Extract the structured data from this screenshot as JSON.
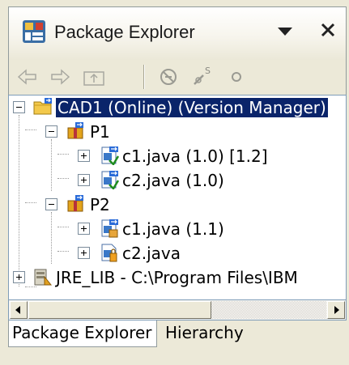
{
  "view": {
    "title": "Package Explorer"
  },
  "toolbar": {
    "buttons": [
      "back",
      "forward",
      "up",
      "collapse-all",
      "link-with-editor",
      "menu"
    ]
  },
  "tree": {
    "root": {
      "label": "CAD1 (Online) (Version Manager)",
      "expanded": true,
      "selected": true
    },
    "p1": {
      "label": "P1",
      "expanded": true
    },
    "p1_c1": {
      "label": "c1.java (1.0) [1.2]"
    },
    "p1_c2": {
      "label": "c2.java (1.0)"
    },
    "p2": {
      "label": "P2",
      "expanded": true
    },
    "p2_c1": {
      "label": "c1.java (1.1)"
    },
    "p2_c2": {
      "label": "c2.java"
    },
    "jre": {
      "label": "JRE_LIB - C:\\Program Files\\IBM"
    }
  },
  "tabs": {
    "active": "Package Explorer",
    "other": "Hierarchy"
  },
  "colors": {
    "selection": "#0a246a",
    "chrome": "#ece9d8",
    "border": "#7f9db9"
  }
}
